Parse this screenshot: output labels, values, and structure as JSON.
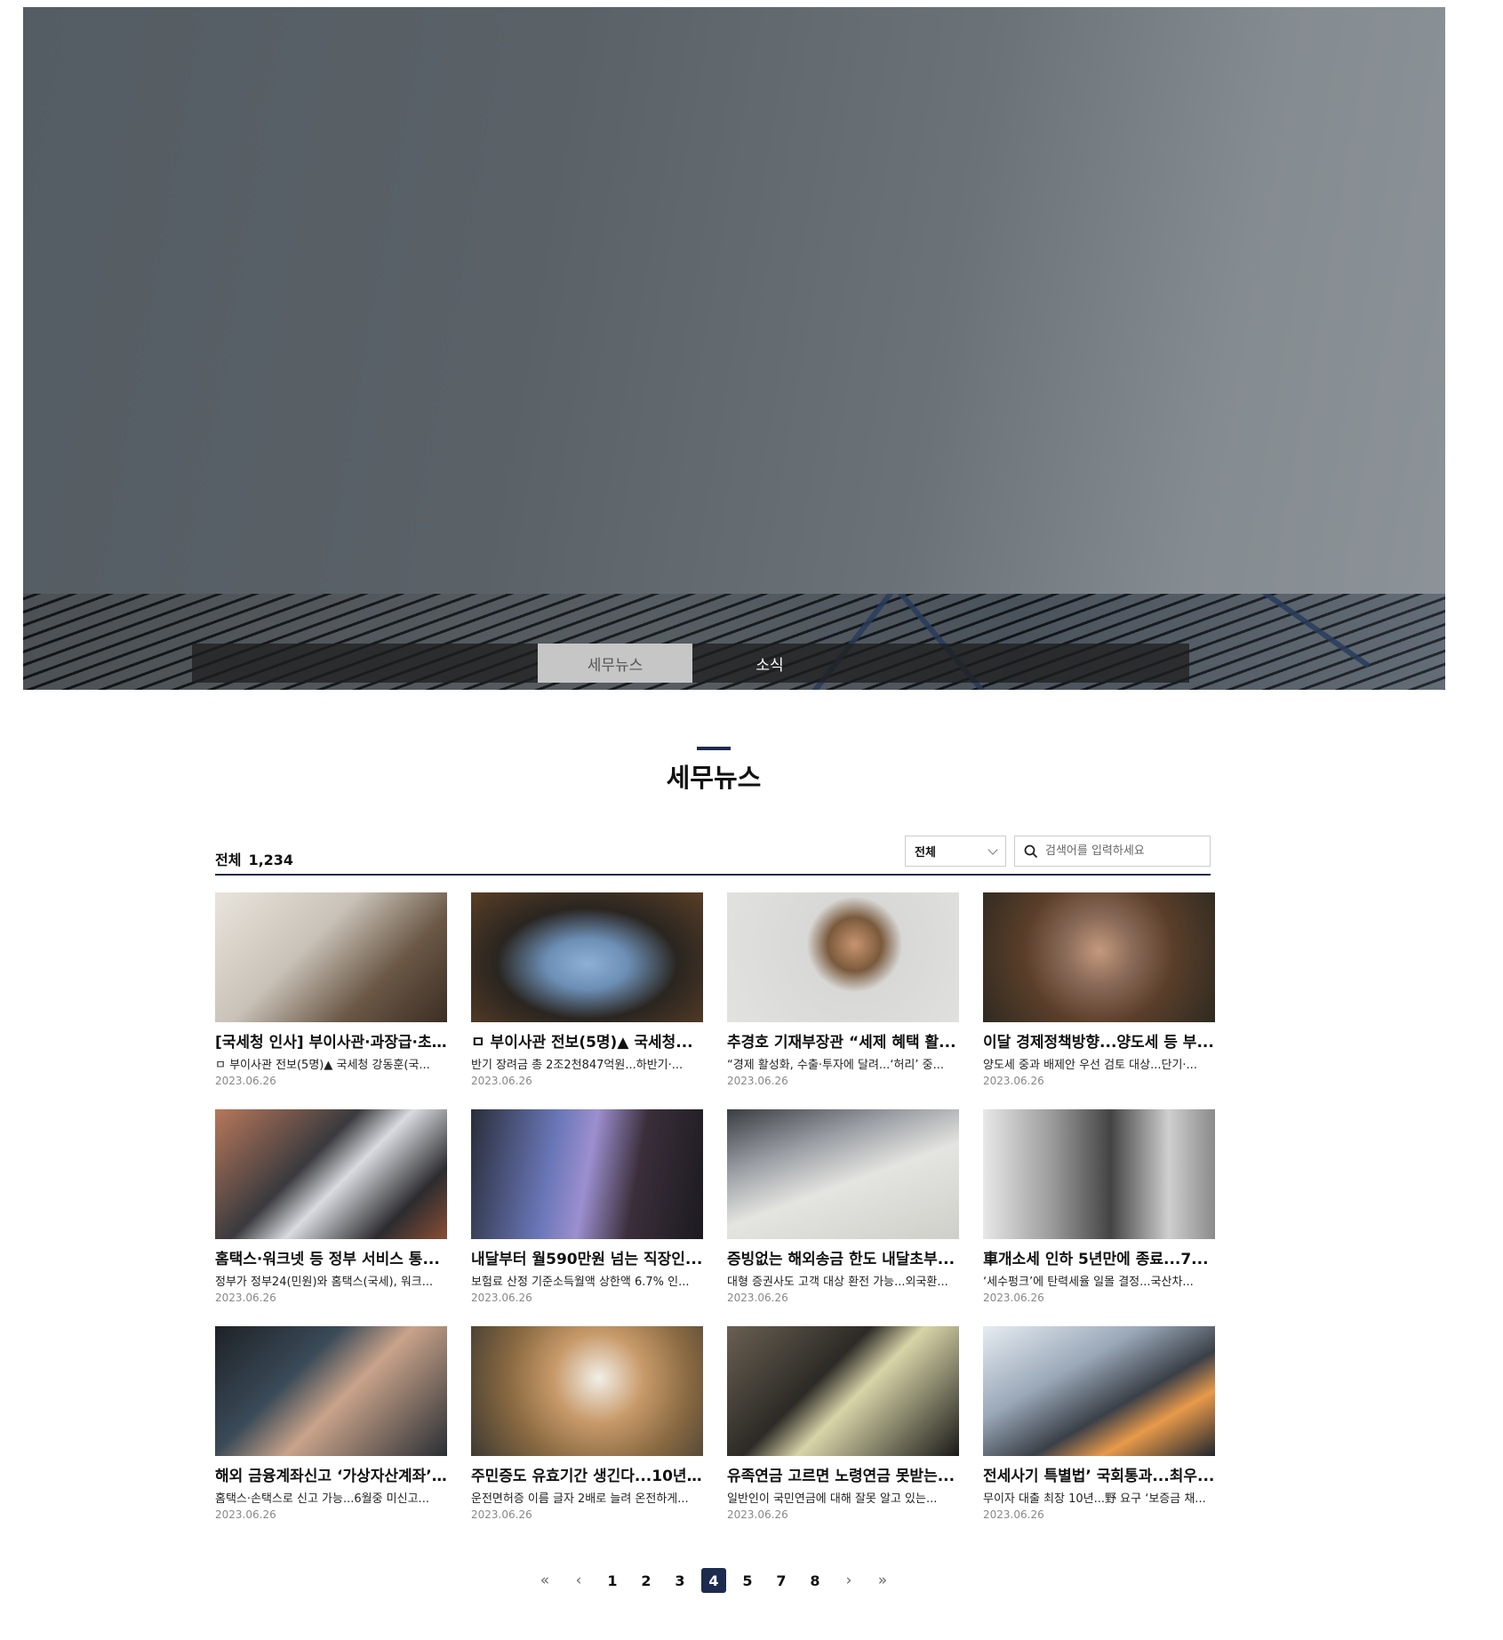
{
  "hero": {
    "tabs": [
      {
        "label": "세무뉴스",
        "active": true
      },
      {
        "label": "소식",
        "active": false
      }
    ]
  },
  "page": {
    "title": "세무뉴스"
  },
  "toolbar": {
    "count_label": "전체",
    "count_value": "1,234",
    "filter_selected": "전체",
    "search_placeholder": "검색어를 입력하세요"
  },
  "articles": [
    {
      "title": "[국세청 인사] 부이사관·과장급·초...",
      "summary": "ㅁ 부이사관 전보(5명)▲ 국세청 강동훈(국...",
      "date": "2023.06.26",
      "image": "hand-writing-photo"
    },
    {
      "title": "ㅁ 부이사관 전보(5명)▲ 국세청...",
      "summary": "반기 장려금 총 2조2천847억원...하반기·...",
      "date": "2023.06.26",
      "image": "skyscraper-upview-photo"
    },
    {
      "title": "추경호 기재부장관 “세제 혜택 활...",
      "summary": "“경제 활성화, 수출·투자에 달려...‘허리’ 중...",
      "date": "2023.06.26",
      "image": "smiling-man-photo"
    },
    {
      "title": "이달 경제정책방향...양도세 등 부...",
      "summary": "양도세 중과 배제안 우선 검토 대상...단기·...",
      "date": "2023.06.26",
      "image": "woman-hijab-photo"
    },
    {
      "title": "홈택스·워크넷 등 정부 서비스 통...",
      "summary": "정부가 정부24(민원)와 홈택스(국세), 워크...",
      "date": "2023.06.26",
      "image": "laptop-website-photo"
    },
    {
      "title": "내달부터 월590만원 넘는 직장인...",
      "summary": "보험료 산정 기준소득월액 상한액 6.7% 인...",
      "date": "2023.06.26",
      "image": "glass-towers-photo"
    },
    {
      "title": "증빙없는 해외송금 한도 내달초부...",
      "summary": "대형 증권사도 고객 대상 환전 가능...외국환...",
      "date": "2023.06.26",
      "image": "glasses-notebook-photo"
    },
    {
      "title": "車개소세 인하 5년만에 종료...7...",
      "summary": "‘세수펑크’에 탄력세율 일몰 결정...국산차...",
      "date": "2023.06.26",
      "image": "office-people-photo"
    },
    {
      "title": "해외 금융계좌신고 ‘가상자산계좌’...",
      "summary": "홈택스·손택스로 신고 가능...6월중 미신고...",
      "date": "2023.06.26",
      "image": "laptop-pointing-photo"
    },
    {
      "title": "주민증도 유효기간 생긴다...10년...",
      "summary": "운전면허증 이름 글자 2배로 늘려 온전하게...",
      "date": "2023.06.26",
      "image": "man-phone-photo"
    },
    {
      "title": "유족연금 고르면 노령연금 못받는...",
      "summary": "일반인이 국민연금에 대해 잘못 알고 있는...",
      "date": "2023.06.26",
      "image": "laptop-desk-photo"
    },
    {
      "title": "전세사기 특별법’ 국회통과...최우...",
      "summary": "무이자 대출 최장 10년...野 요구 ‘보증금 채...",
      "date": "2023.06.26",
      "image": "city-sky-photo"
    }
  ],
  "pagination": {
    "first": "«",
    "prev": "‹",
    "pages": [
      "1",
      "2",
      "3",
      "4",
      "5",
      "7",
      "8"
    ],
    "current": "4",
    "next": "›",
    "last": "»"
  }
}
